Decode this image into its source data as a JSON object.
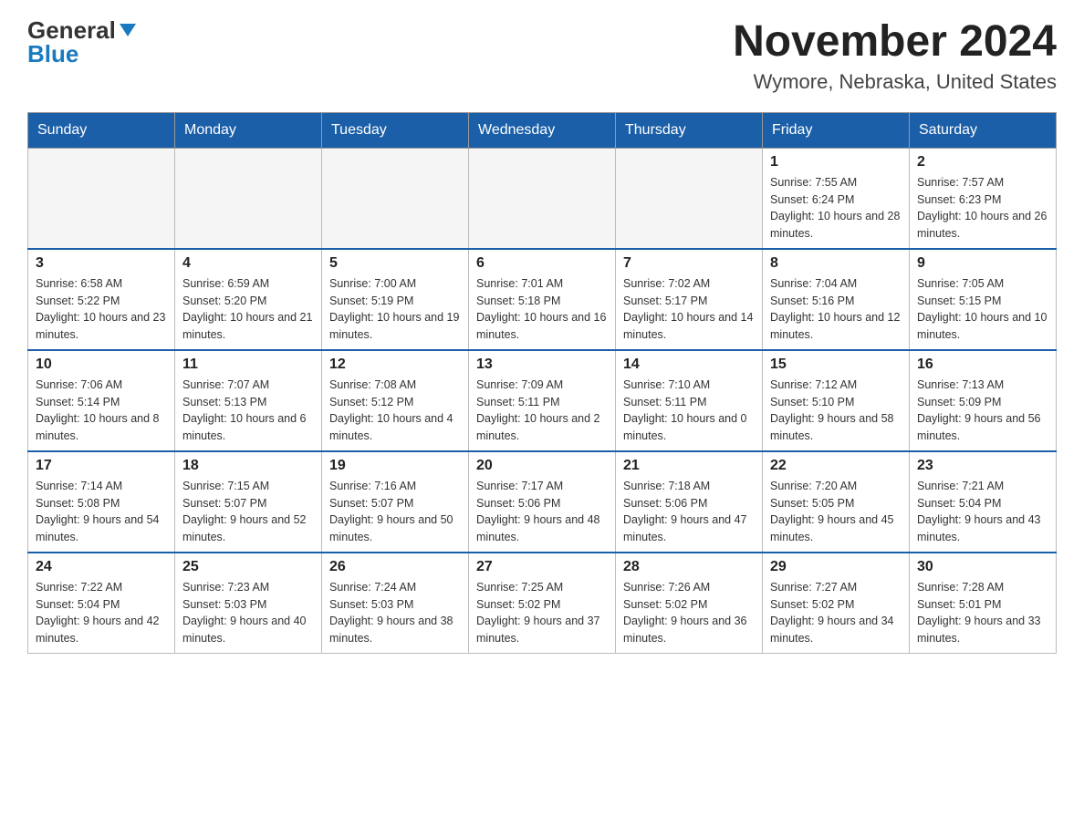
{
  "header": {
    "logo_general": "General",
    "logo_blue": "Blue",
    "month_title": "November 2024",
    "location": "Wymore, Nebraska, United States"
  },
  "weekdays": [
    "Sunday",
    "Monday",
    "Tuesday",
    "Wednesday",
    "Thursday",
    "Friday",
    "Saturday"
  ],
  "weeks": [
    [
      {
        "day": "",
        "info": ""
      },
      {
        "day": "",
        "info": ""
      },
      {
        "day": "",
        "info": ""
      },
      {
        "day": "",
        "info": ""
      },
      {
        "day": "",
        "info": ""
      },
      {
        "day": "1",
        "info": "Sunrise: 7:55 AM\nSunset: 6:24 PM\nDaylight: 10 hours and 28 minutes."
      },
      {
        "day": "2",
        "info": "Sunrise: 7:57 AM\nSunset: 6:23 PM\nDaylight: 10 hours and 26 minutes."
      }
    ],
    [
      {
        "day": "3",
        "info": "Sunrise: 6:58 AM\nSunset: 5:22 PM\nDaylight: 10 hours and 23 minutes."
      },
      {
        "day": "4",
        "info": "Sunrise: 6:59 AM\nSunset: 5:20 PM\nDaylight: 10 hours and 21 minutes."
      },
      {
        "day": "5",
        "info": "Sunrise: 7:00 AM\nSunset: 5:19 PM\nDaylight: 10 hours and 19 minutes."
      },
      {
        "day": "6",
        "info": "Sunrise: 7:01 AM\nSunset: 5:18 PM\nDaylight: 10 hours and 16 minutes."
      },
      {
        "day": "7",
        "info": "Sunrise: 7:02 AM\nSunset: 5:17 PM\nDaylight: 10 hours and 14 minutes."
      },
      {
        "day": "8",
        "info": "Sunrise: 7:04 AM\nSunset: 5:16 PM\nDaylight: 10 hours and 12 minutes."
      },
      {
        "day": "9",
        "info": "Sunrise: 7:05 AM\nSunset: 5:15 PM\nDaylight: 10 hours and 10 minutes."
      }
    ],
    [
      {
        "day": "10",
        "info": "Sunrise: 7:06 AM\nSunset: 5:14 PM\nDaylight: 10 hours and 8 minutes."
      },
      {
        "day": "11",
        "info": "Sunrise: 7:07 AM\nSunset: 5:13 PM\nDaylight: 10 hours and 6 minutes."
      },
      {
        "day": "12",
        "info": "Sunrise: 7:08 AM\nSunset: 5:12 PM\nDaylight: 10 hours and 4 minutes."
      },
      {
        "day": "13",
        "info": "Sunrise: 7:09 AM\nSunset: 5:11 PM\nDaylight: 10 hours and 2 minutes."
      },
      {
        "day": "14",
        "info": "Sunrise: 7:10 AM\nSunset: 5:11 PM\nDaylight: 10 hours and 0 minutes."
      },
      {
        "day": "15",
        "info": "Sunrise: 7:12 AM\nSunset: 5:10 PM\nDaylight: 9 hours and 58 minutes."
      },
      {
        "day": "16",
        "info": "Sunrise: 7:13 AM\nSunset: 5:09 PM\nDaylight: 9 hours and 56 minutes."
      }
    ],
    [
      {
        "day": "17",
        "info": "Sunrise: 7:14 AM\nSunset: 5:08 PM\nDaylight: 9 hours and 54 minutes."
      },
      {
        "day": "18",
        "info": "Sunrise: 7:15 AM\nSunset: 5:07 PM\nDaylight: 9 hours and 52 minutes."
      },
      {
        "day": "19",
        "info": "Sunrise: 7:16 AM\nSunset: 5:07 PM\nDaylight: 9 hours and 50 minutes."
      },
      {
        "day": "20",
        "info": "Sunrise: 7:17 AM\nSunset: 5:06 PM\nDaylight: 9 hours and 48 minutes."
      },
      {
        "day": "21",
        "info": "Sunrise: 7:18 AM\nSunset: 5:06 PM\nDaylight: 9 hours and 47 minutes."
      },
      {
        "day": "22",
        "info": "Sunrise: 7:20 AM\nSunset: 5:05 PM\nDaylight: 9 hours and 45 minutes."
      },
      {
        "day": "23",
        "info": "Sunrise: 7:21 AM\nSunset: 5:04 PM\nDaylight: 9 hours and 43 minutes."
      }
    ],
    [
      {
        "day": "24",
        "info": "Sunrise: 7:22 AM\nSunset: 5:04 PM\nDaylight: 9 hours and 42 minutes."
      },
      {
        "day": "25",
        "info": "Sunrise: 7:23 AM\nSunset: 5:03 PM\nDaylight: 9 hours and 40 minutes."
      },
      {
        "day": "26",
        "info": "Sunrise: 7:24 AM\nSunset: 5:03 PM\nDaylight: 9 hours and 38 minutes."
      },
      {
        "day": "27",
        "info": "Sunrise: 7:25 AM\nSunset: 5:02 PM\nDaylight: 9 hours and 37 minutes."
      },
      {
        "day": "28",
        "info": "Sunrise: 7:26 AM\nSunset: 5:02 PM\nDaylight: 9 hours and 36 minutes."
      },
      {
        "day": "29",
        "info": "Sunrise: 7:27 AM\nSunset: 5:02 PM\nDaylight: 9 hours and 34 minutes."
      },
      {
        "day": "30",
        "info": "Sunrise: 7:28 AM\nSunset: 5:01 PM\nDaylight: 9 hours and 33 minutes."
      }
    ]
  ]
}
